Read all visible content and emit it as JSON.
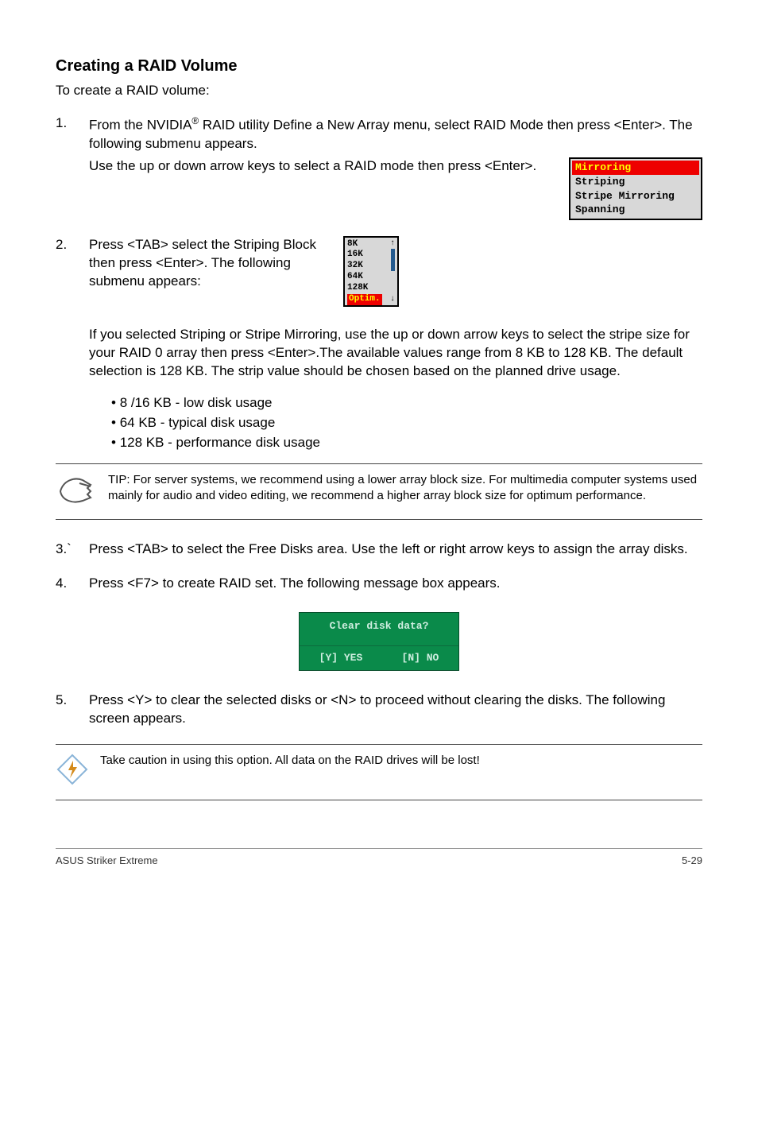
{
  "heading": "Creating a RAID Volume",
  "intro": "To create a RAID volume:",
  "steps": {
    "s1": {
      "num": "1.",
      "p1a": "From the NVIDIA",
      "p1b": " RAID utility Define a New Array menu, select RAID Mode then press <Enter>. The following submenu appears.",
      "p2": "Use the up or down arrow keys to select a RAID mode then press <Enter>."
    },
    "s2": {
      "num": "2.",
      "p1": "Press <TAB> select the Striping Block then press <Enter>. The following submenu appears:",
      "p2": "If you selected Striping or Stripe Mirroring, use the up or down arrow keys to select the stripe size for your RAID 0 array then press <Enter>.The available values range from 8 KB to 128 KB. The default selection is 128 KB. The strip value should be chosen based on the planned drive usage."
    },
    "s3": {
      "num": "3.`",
      "p1": "Press <TAB> to select the Free Disks area. Use the left or right arrow keys to assign the array disks."
    },
    "s4": {
      "num": "4.",
      "p1": "Press <F7> to create RAID set. The following message box appears."
    },
    "s5": {
      "num": "5.",
      "p1": "Press <Y> to clear the selected disks or <N> to proceed without clearing the disks. The following screen appears."
    }
  },
  "raid_modes": {
    "selected": "Mirroring",
    "opts": [
      "Striping",
      "Stripe Mirroring",
      "Spanning"
    ]
  },
  "stripe_sizes": {
    "opts": [
      "8K",
      "16K",
      "32K",
      "64K",
      "128K"
    ],
    "selected": "Optim."
  },
  "bullets": {
    "b1": "8 /16 KB - low disk usage",
    "b2": "64 KB - typical disk usage",
    "b3": "128 KB - performance disk usage"
  },
  "tip": "TIP: For server systems, we recommend using a lower array block size. For multimedia computer systems used mainly for audio and video editing, we recommend a higher array block size for optimum performance.",
  "dialog": {
    "title": "Clear disk data?",
    "yes": "[Y] YES",
    "no": "[N] NO"
  },
  "caution": "Take caution in using this option. All data on the RAID drives will be lost!",
  "footer": {
    "left": "ASUS Striker Extreme",
    "right": "5-29"
  }
}
